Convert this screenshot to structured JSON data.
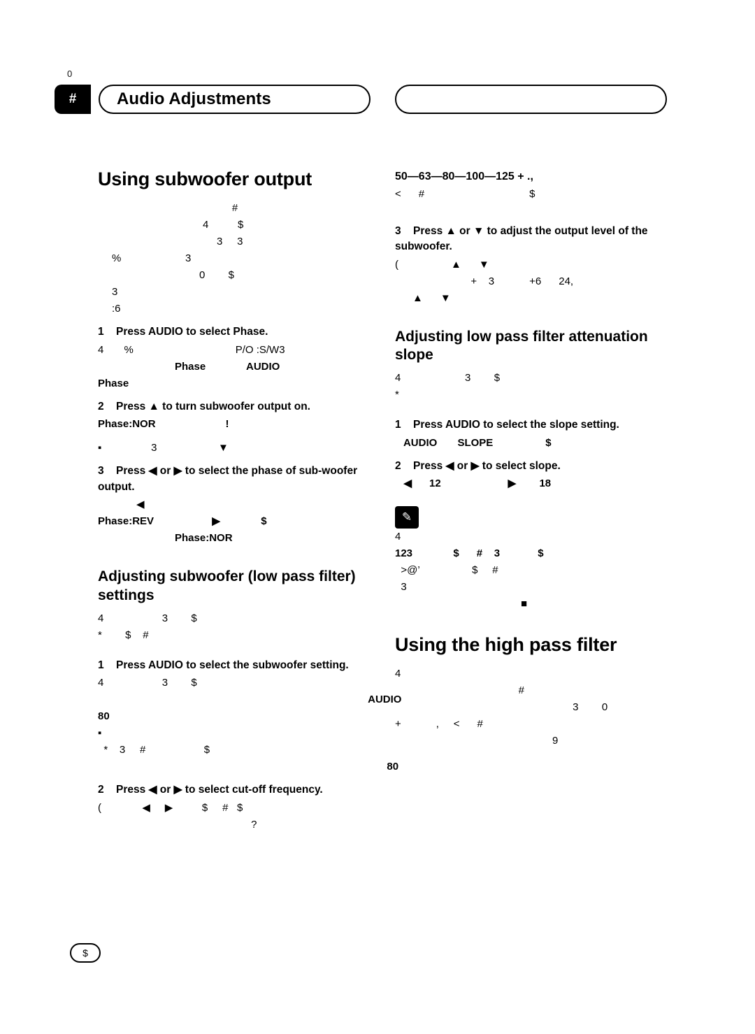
{
  "page": {
    "number": "0",
    "header_tab_symbol": "#",
    "header_title": "Audio Adjustments",
    "bottom_marker": "$"
  },
  "left_column": {
    "heading": "Using subwoofer output",
    "intro_lines": [
      "#",
      "4          $",
      "3     3",
      "%                      3",
      "0        $",
      "3",
      ":6"
    ],
    "step1": {
      "num": "1",
      "text": "Press AUDIO to select Phase.",
      "lines": [
        "4       %                                   P/O :S/W3",
        "Phase              AUDIO",
        "Phase"
      ]
    },
    "step2": {
      "num": "2",
      "text": "Press ▲ to turn subwoofer output on.",
      "lines": [
        "Phase:NOR                        !",
        "▪                 3                     ▼"
      ]
    },
    "step3": {
      "num": "3",
      "text": "Press ◀ or ▶ to select the phase of sub-woofer output.",
      "lines": [
        "◀",
        "Phase:REV                    ▶              $",
        "Phase:NOR"
      ]
    },
    "subheading2": "Adjusting subwoofer (low pass filter) settings",
    "sub2_lines": [
      "4                    3        $",
      "*        $    #"
    ],
    "sub2_step1": {
      "num": "1",
      "text": "Press AUDIO to select the subwoofer setting.",
      "lines": [
        "4                    3        $",
        "                                  AUDIO",
        "80",
        "▪",
        "  *    3     #                    $",
        "                                      80"
      ]
    },
    "sub2_step2": {
      "num": "2",
      "text": "Press ◀ or ▶ to select cut-off frequency.",
      "lines": [
        "(              ◀     ▶          $     #   $",
        "                   ?"
      ]
    }
  },
  "right_column": {
    "freq_line": "50—63—80—100—125 + .,",
    "freq_line2": "<      #                                    $",
    "step3": {
      "num": "3",
      "text": "Press ▲ or ▼ to adjust the output level of the subwoofer.",
      "lines": [
        "(                  ▲      ▼",
        "                          +    3            +6      24,",
        "      ▲      ▼"
      ]
    },
    "heading2": "Adjusting low pass filter attenuation slope",
    "heading2_lines": [
      "4                      3        $",
      "*"
    ],
    "h2_step1": {
      "num": "1",
      "text": "Press AUDIO to select the slope setting.",
      "lines": [
        "   AUDIO       SLOPE                  $"
      ]
    },
    "h2_step2": {
      "num": "2",
      "text": "Press ◀ or ▶ to select slope.",
      "lines": [
        "   ◀      12                       ▶        18"
      ]
    },
    "note_lines": [
      "4",
      "123              $      #    3             $",
      "  >@’                  $     #",
      "  3"
    ],
    "note_end_symbol": "■",
    "heading3": "Using the high pass filter",
    "heading3_lines": [
      "4",
      "                #",
      "                         3        0",
      "+            ,     <      #",
      "                  9"
    ]
  }
}
